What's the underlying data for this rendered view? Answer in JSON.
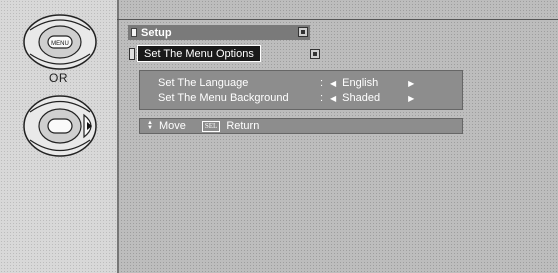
{
  "left_panel": {
    "or_label": "OR",
    "remote_top_button": "MENU"
  },
  "window": {
    "title": "Setup",
    "subtitle": "Set The Menu Options"
  },
  "menu": {
    "items": [
      {
        "label": "Set The Language",
        "value": "English"
      },
      {
        "label": "Set The Menu Background",
        "value": "Shaded"
      }
    ],
    "colon": ":"
  },
  "footer": {
    "move_label": "Move",
    "sel_key": "SEL",
    "return_label": "Return"
  }
}
